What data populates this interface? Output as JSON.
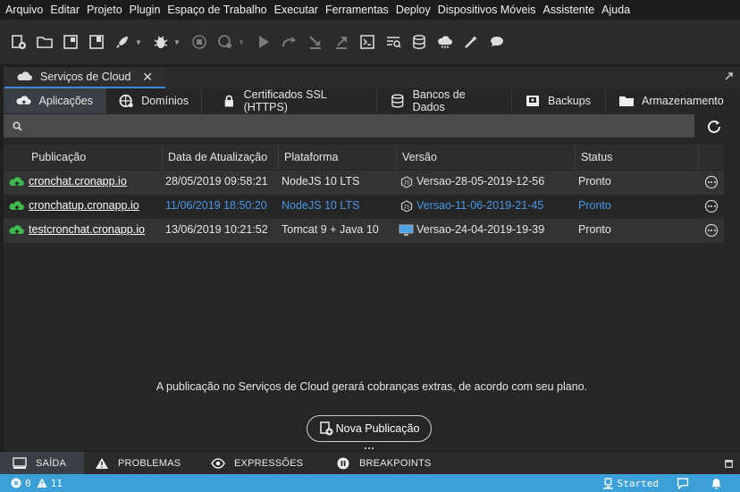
{
  "menu": [
    "Arquivo",
    "Editar",
    "Projeto",
    "Plugin",
    "Espaço de Trabalho",
    "Executar",
    "Ferramentas",
    "Deploy",
    "Dispositivos Móveis",
    "Assistente",
    "Ajuda"
  ],
  "toolbar_icons": [
    "new-project-icon",
    "open-folder-icon",
    "window-icon",
    "save-icon",
    "rocket-icon",
    "bug-icon",
    "stop-icon",
    "debug-icon",
    "play-icon",
    "step-over-icon",
    "step-into-icon",
    "step-out-icon",
    "terminal-icon",
    "search-list-icon",
    "database-icon",
    "cloud-icon",
    "magic-wand-icon",
    "chat-icon"
  ],
  "doc_tab": {
    "title": "Serviços de Cloud",
    "close": "✕"
  },
  "subtabs": [
    "Aplicações",
    "Domínios",
    "Certificados SSL (HTTPS)",
    "Bancos de Dados",
    "Backups",
    "Armazenamento"
  ],
  "filter": {
    "placeholder": ""
  },
  "table": {
    "headers": [
      "Publicação",
      "Data de Atualização",
      "Plataforma",
      "Versão",
      "Status"
    ],
    "rows": [
      {
        "name": "cronchat.cronapp.io",
        "date": "28/05/2019 09:58:21",
        "platform": "NodeJS 10 LTS",
        "version": "Versao-28-05-2019-12-56",
        "status": "Pronto",
        "highlight": false
      },
      {
        "name": "cronchatup.cronapp.io",
        "date": "11/06/2019 18:50:20",
        "platform": "NodeJS 10 LTS",
        "version": "Versao-11-06-2019-21-45",
        "status": "Pronto",
        "highlight": true
      },
      {
        "name": "testcronchat.cronapp.io",
        "date": "13/06/2019 10:21:52",
        "platform": "Tomcat 9 + Java 10",
        "version": "Versao-24-04-2019-19-39",
        "status": "Pronto",
        "highlight": false
      }
    ]
  },
  "notice": "A publicação no Serviços de Cloud gerará cobranças extras, de acordo com seu plano.",
  "new_button": "Nova Publicação",
  "bottom_tabs": [
    "SAÍDA",
    "PROBLEMAS",
    "EXPRESSÕES",
    "BREAKPOINTS"
  ],
  "statusbar": {
    "errors": "0",
    "warnings": "11",
    "started": "Started"
  },
  "colors": {
    "accent": "#3b9fd8",
    "highlight_text": "#4a96e6",
    "cloud_green": "#3fb950"
  }
}
